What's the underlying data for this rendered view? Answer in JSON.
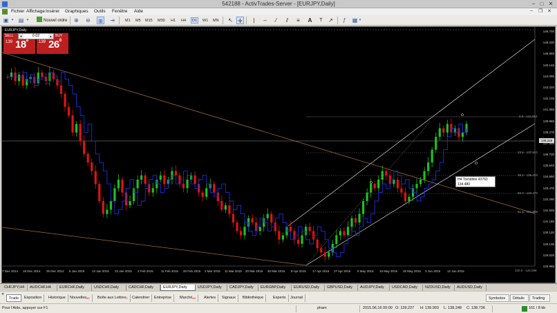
{
  "window": {
    "title": "542188 - ActivTrades-Server - [EURJPY,Daily]"
  },
  "menu": [
    "Fichier",
    "Affichage",
    "Insérer",
    "Graphiques",
    "Outils",
    "Fenêtre",
    "Aide"
  ],
  "toolbar": {
    "new_order_label": "Nouvel ordre",
    "timeframes": [
      "M1",
      "M5",
      "M15",
      "M30",
      "H1",
      "H4",
      "D1",
      "W1",
      "MN"
    ],
    "active_timeframe": "D1"
  },
  "chart": {
    "label": "EURJPY,Daily",
    "trading_panel": {
      "sell_label": "SELL",
      "buy_label": "BUY",
      "lot_value": "0.02",
      "sell_big": "139",
      "sell_pips": "18",
      "sell_sup": "8",
      "buy_big": "139",
      "buy_pips": "26",
      "buy_sup": "8"
    },
    "price_ticks": [
      "149.700",
      "148.230",
      "146.655",
      "145.145",
      "144.095",
      "143.220",
      "142.105",
      "141.395",
      "139.985",
      "138.275",
      "137.595",
      "136.730",
      "135.640",
      "134.650",
      "133.475",
      "132.290",
      "131.525",
      "131.180",
      "130.120",
      "129.135",
      "128.025",
      "126.965"
    ],
    "current_price": "139.248",
    "date_ticks": [
      "7 Dec 2014",
      "16 Dec 2014",
      "26 Dec 2014",
      "5 Jan 2015",
      "14 Jan 2015",
      "23 Jan 2015",
      "2 Feb 2015",
      "11 Feb 2015",
      "20 Feb 2015",
      "3 Mar 2015",
      "11 Mar 2015",
      "20 Mar 2015",
      "30 Mar 2015",
      "8 Apr 2015",
      "17 Apr 2015",
      "27 Apr 2015",
      "6 May 2015",
      "15 May 2015",
      "26 May 2015",
      "3 Jun 2015",
      "12 Jun 2015"
    ],
    "fibo_levels": [
      "0.0 - 141.053",
      "23.6 - 137.622",
      "38.2 - 135.203",
      "50.0 - 133.475",
      "61.8 - 131.896",
      "100.0 - 126.098"
    ],
    "tooltip": {
      "line1": "H4 Trendline 43760",
      "line2": "134.480"
    }
  },
  "chart_tabs": [
    "CHFJPY,H4",
    "AUDCHF,H4",
    "EURCHF,Daily",
    "USDCHF,Daily",
    "CADCHF,Daily",
    "EURJPY,Daily",
    "USDJPY,Daily",
    "CADJPY,Daily",
    "EURGBP,Daily",
    "EURUSD,Daily",
    "GBPUSD,Daily",
    "AUDJPY,Daily",
    "USDCAD,Daily",
    "NZDUSD,Daily",
    "AUDUSD,Daily"
  ],
  "active_chart_tab": "EURJPY,Daily",
  "terminal_tabs": [
    {
      "label": "Trade",
      "badge": ""
    },
    {
      "label": "Exposition",
      "badge": ""
    },
    {
      "label": "Historique",
      "badge": ""
    },
    {
      "label": "Nouvelles",
      "badge": "99"
    },
    {
      "label": "Boîte aux Lettres",
      "badge": "7"
    },
    {
      "label": "Calendrier",
      "badge": ""
    },
    {
      "label": "Entreprise",
      "badge": ""
    },
    {
      "label": "Marché",
      "badge": "63"
    },
    {
      "label": "Alertes",
      "badge": ""
    },
    {
      "label": "Signaux",
      "badge": ""
    },
    {
      "label": "Bibliothèque",
      "badge": ""
    },
    {
      "label": "Experts",
      "badge": ""
    },
    {
      "label": "Journal",
      "badge": ""
    }
  ],
  "side_tabs": [
    "Symboles",
    "Détails",
    "Trading"
  ],
  "status": {
    "help": "Pour l'Aide, appuyer sur F1",
    "profile": "pham",
    "datetime": "2015.06.16 00:00",
    "open": "O: 139.227",
    "high": "H: 139.993",
    "low": "L: 138.248",
    "close": "C: 138.736",
    "traffic": "161 / 8 kb"
  },
  "colors": {
    "bull": "#1fc11f",
    "bear": "#e01313",
    "ma": "#1d2fe0",
    "channel": "#d8d8d8",
    "trendline": "#a06a3a"
  }
}
